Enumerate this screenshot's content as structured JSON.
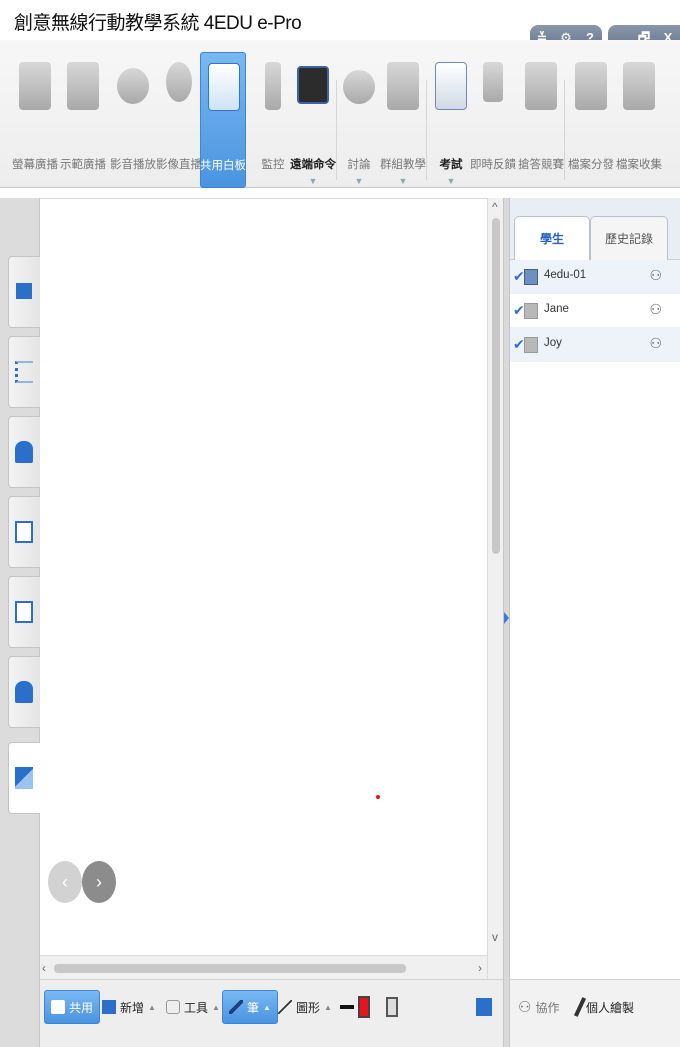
{
  "app": {
    "title": "創意無線行動教學系統 4EDU e-Pro",
    "window_buttons": [
      "≚",
      "⚙",
      "?",
      "_",
      "🗗",
      "X"
    ]
  },
  "ribbon": {
    "buttons": [
      {
        "label": "螢幕廣播",
        "icon": "monitor-icon",
        "enabled": false
      },
      {
        "label": "示範廣播",
        "icon": "presenter-icon",
        "enabled": false
      },
      {
        "label": "影音播放",
        "icon": "film-reel-icon",
        "enabled": false
      },
      {
        "label": "影像直播",
        "icon": "webcam-icon",
        "enabled": false
      },
      {
        "label": "共用白板",
        "icon": "whiteboard-pen-icon",
        "enabled": true,
        "active": true
      },
      {
        "label": "監控",
        "icon": "monitor-user-icon",
        "enabled": false
      },
      {
        "label": "遠端命令",
        "icon": "terminal-icon",
        "enabled": true,
        "dropdown": true
      },
      {
        "label": "討論",
        "icon": "chat-bubbles-icon",
        "enabled": false,
        "dropdown": true
      },
      {
        "label": "群組教學",
        "icon": "group-icon",
        "enabled": false,
        "dropdown": true
      },
      {
        "label": "考試",
        "icon": "exam-clock-icon",
        "enabled": true,
        "dropdown": true
      },
      {
        "label": "即時反饋",
        "icon": "feedback-list-icon",
        "enabled": false
      },
      {
        "label": "搶答競賽",
        "icon": "quiz-star-icon",
        "enabled": false
      },
      {
        "label": "檔案分發",
        "icon": "file-send-icon",
        "enabled": false
      },
      {
        "label": "檔案收集",
        "icon": "file-collect-icon",
        "enabled": false
      }
    ],
    "dropdown_glyph": "▼"
  },
  "left_tabs": [
    {
      "icon": "grid-view-icon"
    },
    {
      "icon": "list-view-icon"
    },
    {
      "icon": "user-minus-icon"
    },
    {
      "icon": "document-icon"
    },
    {
      "icon": "exam-clock-icon"
    },
    {
      "icon": "user-star-icon"
    },
    {
      "icon": "whiteboard-pen-icon",
      "active": true
    }
  ],
  "whiteboard": {
    "prev_glyph": "‹",
    "next_glyph": "›"
  },
  "right_panel": {
    "tabs": [
      {
        "label": "學生",
        "active": true
      },
      {
        "label": "歷史記錄",
        "active": false
      }
    ],
    "students": [
      {
        "name": "4edu-01",
        "checked": true,
        "online": true
      },
      {
        "name": "Jane",
        "checked": true,
        "online": false
      },
      {
        "name": "Joy",
        "checked": true,
        "online": false
      }
    ],
    "check_glyph": "✔",
    "share_glyph": "⚇"
  },
  "bottom_toolbar": {
    "items": [
      {
        "label": "共用",
        "icon": "share-icon",
        "active": true
      },
      {
        "label": "新增",
        "icon": "new-page-icon",
        "dropdown": true
      },
      {
        "label": "工具",
        "icon": "hand-tool-icon",
        "dropdown": true
      },
      {
        "label": "筆",
        "icon": "pen-icon",
        "active": true,
        "dropdown": true
      },
      {
        "label": "圖形",
        "icon": "line-shape-icon",
        "dropdown": true
      }
    ],
    "pen_color": "#e8141a",
    "dropdown_glyph": "▲"
  },
  "right_bottom": {
    "items": [
      {
        "label": "協作",
        "icon": "collaborate-icon"
      },
      {
        "label": "個人繪製",
        "icon": "brush-icon"
      }
    ]
  },
  "colors": {
    "accent": "#4a94e0",
    "pen_dot": "#e8141a"
  }
}
